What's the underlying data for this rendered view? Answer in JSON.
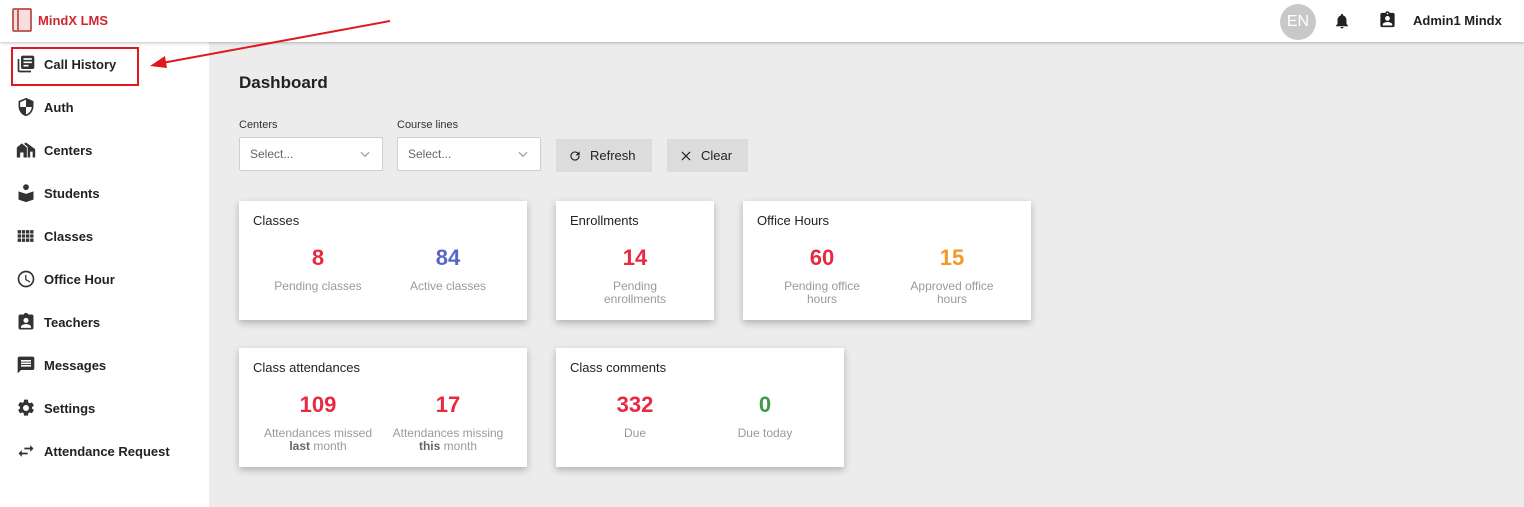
{
  "app": {
    "logo_text": "MindX LMS",
    "lang": "EN",
    "user": "Admin1 Mindx"
  },
  "sidebar": {
    "items": [
      {
        "label": "Call History",
        "icon": "library-books-icon"
      },
      {
        "label": "Auth",
        "icon": "shield-icon"
      },
      {
        "label": "Centers",
        "icon": "buildings-icon"
      },
      {
        "label": "Students",
        "icon": "student-icon"
      },
      {
        "label": "Classes",
        "icon": "grid-icon"
      },
      {
        "label": "Office Hour",
        "icon": "clock-icon"
      },
      {
        "label": "Teachers",
        "icon": "badge-icon"
      },
      {
        "label": "Messages",
        "icon": "message-icon"
      },
      {
        "label": "Settings",
        "icon": "gear-icon"
      },
      {
        "label": "Attendance Request",
        "icon": "swap-icon"
      }
    ]
  },
  "main": {
    "title": "Dashboard",
    "filters": {
      "centers_label": "Centers",
      "centers_placeholder": "Select...",
      "courselines_label": "Course lines",
      "courselines_placeholder": "Select...",
      "refresh_label": "Refresh",
      "clear_label": "Clear"
    },
    "cards": {
      "classes": {
        "title": "Classes",
        "pending_value": "8",
        "pending_label": "Pending classes",
        "active_value": "84",
        "active_label": "Active classes"
      },
      "enrollments": {
        "title": "Enrollments",
        "pending_value": "14",
        "pending_label": "Pending enrollments"
      },
      "office_hours": {
        "title": "Office Hours",
        "pending_value": "60",
        "pending_label": "Pending office hours",
        "approved_value": "15",
        "approved_label": "Approved office hours"
      },
      "attendances": {
        "title": "Class attendances",
        "last_value": "109",
        "last_label_pre": "Attendances missed ",
        "last_label_bold": "last",
        "last_label_post": " month",
        "this_value": "17",
        "this_label_pre": "Attendances missing ",
        "this_label_bold": "this",
        "this_label_post": " month"
      },
      "comments": {
        "title": "Class comments",
        "due_value": "332",
        "due_label": "Due",
        "today_value": "0",
        "today_label": "Due today"
      }
    }
  },
  "colors": {
    "red": "#e8293f",
    "blue": "#5867c7",
    "orange": "#f29a26",
    "green": "#3e9a45"
  }
}
